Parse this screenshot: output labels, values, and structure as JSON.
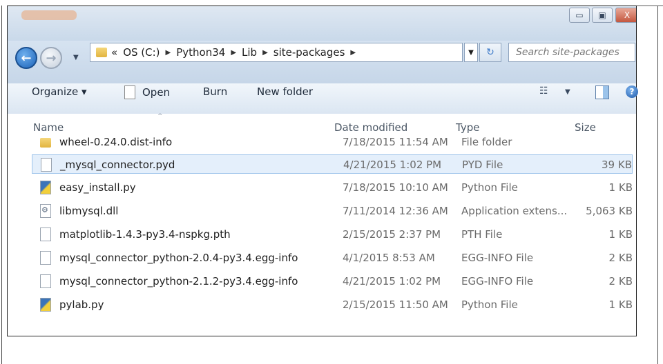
{
  "window": {
    "controls": {
      "minimize": "▭",
      "maximize": "▣",
      "close": "X"
    }
  },
  "nav": {
    "back_glyph": "←",
    "forward_glyph": "→",
    "dropdown_glyph": "▼"
  },
  "address": {
    "prefix": "«",
    "crumbs": [
      "OS (C:)",
      "Python34",
      "Lib",
      "site-packages"
    ],
    "separator": "▶",
    "dropdown_glyph": "▼",
    "refresh_glyph": "↻"
  },
  "search": {
    "placeholder": "Search site-packages"
  },
  "toolbar": {
    "organize": "Organize ▾",
    "open": "Open",
    "burn": "Burn",
    "new_folder": "New folder",
    "view_glyph": "☷",
    "view_dropdown": "▼",
    "help_glyph": "?"
  },
  "columns": {
    "name": "Name",
    "date": "Date modified",
    "type": "Type",
    "size": "Size",
    "sort_glyph": "^"
  },
  "files": [
    {
      "name": "wheel-0.24.0.dist-info",
      "date": "7/18/2015 11:54 AM",
      "type": "File folder",
      "size": "",
      "icon": "folder-icon"
    },
    {
      "name": "_mysql_connector.pyd",
      "date": "4/21/2015 1:02 PM",
      "type": "PYD File",
      "size": "39 KB",
      "icon": "file-icon",
      "selected": true
    },
    {
      "name": "easy_install.py",
      "date": "7/18/2015 10:10 AM",
      "type": "Python File",
      "size": "1 KB",
      "icon": "python-file-icon"
    },
    {
      "name": "libmysql.dll",
      "date": "7/11/2014 12:36 AM",
      "type": "Application extens...",
      "size": "5,063 KB",
      "icon": "dll-file-icon"
    },
    {
      "name": "matplotlib-1.4.3-py3.4-nspkg.pth",
      "date": "2/15/2015 2:37 PM",
      "type": "PTH File",
      "size": "1 KB",
      "icon": "file-icon"
    },
    {
      "name": "mysql_connector_python-2.0.4-py3.4.egg-info",
      "date": "4/1/2015 8:53 AM",
      "type": "EGG-INFO File",
      "size": "2 KB",
      "icon": "file-icon"
    },
    {
      "name": "mysql_connector_python-2.1.2-py3.4.egg-info",
      "date": "4/21/2015 1:02 PM",
      "type": "EGG-INFO File",
      "size": "2 KB",
      "icon": "file-icon"
    },
    {
      "name": "pylab.py",
      "date": "2/15/2015 11:50 AM",
      "type": "Python File",
      "size": "1 KB",
      "icon": "python-file-icon"
    }
  ]
}
